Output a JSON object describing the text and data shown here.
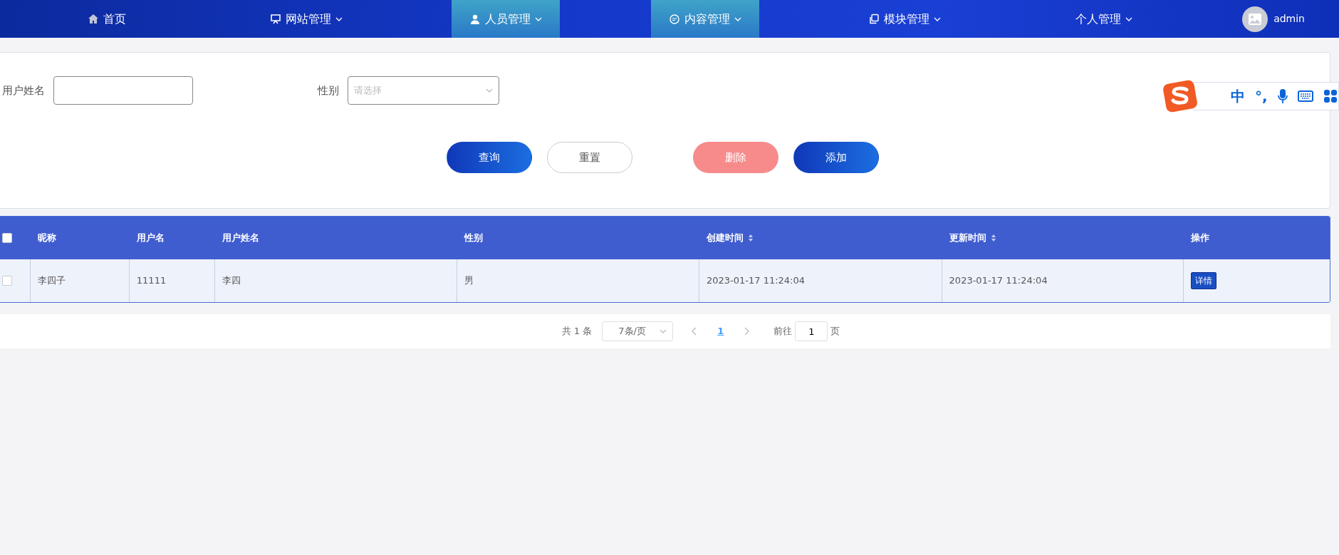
{
  "nav": {
    "items": [
      {
        "label": "首页",
        "dropdown": false,
        "highlighted": false
      },
      {
        "label": "网站管理",
        "dropdown": true,
        "highlighted": false
      },
      {
        "label": "人员管理",
        "dropdown": true,
        "highlighted": true
      },
      {
        "label": "内容管理",
        "dropdown": true,
        "highlighted": true
      },
      {
        "label": "模块管理",
        "dropdown": true,
        "highlighted": false
      },
      {
        "label": "个人管理",
        "dropdown": true,
        "highlighted": false
      }
    ],
    "user": {
      "name": "admin"
    }
  },
  "filters": [
    {
      "label": "用户姓名",
      "kind": "text"
    },
    {
      "label": "性别",
      "kind": "select",
      "placeholder": "请选择"
    }
  ],
  "buttons": [
    {
      "label": "查询",
      "kind": "primary"
    },
    {
      "label": "重置",
      "kind": "plain"
    },
    {
      "label": "删除",
      "kind": "danger"
    },
    {
      "label": "添加",
      "kind": "primary"
    }
  ],
  "table": {
    "columns": [
      {
        "label": "昵称",
        "sortable": false
      },
      {
        "label": "用户名",
        "sortable": false
      },
      {
        "label": "用户姓名",
        "sortable": false
      },
      {
        "label": "性别",
        "sortable": false
      },
      {
        "label": "创建时间",
        "sortable": true
      },
      {
        "label": "更新时间",
        "sortable": true
      },
      {
        "label": "操作",
        "sortable": false
      }
    ],
    "select_all_checked": false,
    "rows": [
      {
        "checked": false,
        "cells": [
          "李四子",
          "11111",
          "李四",
          "男",
          "2023-01-17 11:24:04",
          "2023-01-17 11:24:04"
        ],
        "action": "详情"
      }
    ]
  },
  "pagination": {
    "total": "共 1 条",
    "page_size": "7条/页",
    "pages": [
      {
        "label": "1",
        "selected": true
      }
    ],
    "goto_label": "前往",
    "goto_value": "1",
    "page_unit": "页"
  },
  "ime_toolbar": {
    "items": [
      {
        "text": "中",
        "kind": "text"
      },
      {
        "text": "°,",
        "kind": "text"
      },
      {
        "kind": "mic"
      },
      {
        "kind": "keyboard"
      },
      {
        "kind": "apps"
      }
    ]
  }
}
